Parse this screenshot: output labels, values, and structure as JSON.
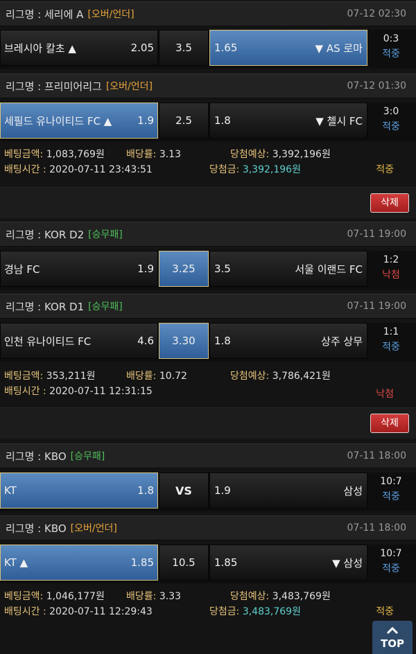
{
  "league_prefix": "리그명 : ",
  "colors": {
    "over_under": "#e8a63c",
    "win_draw_loss": "#4fbf5a",
    "hit": "#5a9ede",
    "miss": "#e04848"
  },
  "slips": [
    {
      "games": [
        {
          "league": "세리에 A",
          "type": "[오버/언더]",
          "type_color": "#e8a63c",
          "time": "07-12 02:30",
          "home": "브레시아 칼초 ▲",
          "home_odds": "2.05",
          "mid": "3.5",
          "away_odds": "1.65",
          "away": "▼ AS 로마",
          "selected": "away",
          "score": "0:3",
          "status": "적중"
        },
        {
          "league": "프리미어리그",
          "type": "[오버/언더]",
          "type_color": "#e8a63c",
          "time": "07-12 01:30",
          "home": "세필드 유나이티드 FC ▲",
          "home_odds": "1.9",
          "mid": "2.5",
          "away_odds": "1.8",
          "away": "▼ 첼시 FC",
          "selected": "home",
          "score": "3:0",
          "status": "적중"
        }
      ],
      "bet_amount_label": "베팅금액:",
      "bet_amount": "1,083,769원",
      "odds_label": "배당률:",
      "odds": "3.13",
      "expected_label": "당첨예상:",
      "expected": "3,392,196원",
      "bet_time_label": "배팅시간 : ",
      "bet_time": "2020-07-11 23:43:51",
      "win_label": "당첨금: ",
      "win_amount": "3,392,196원",
      "status": "적중",
      "delete_label": "삭제"
    },
    {
      "games": [
        {
          "league": "KOR D2",
          "type": "[승무패]",
          "type_color": "#4fbf5a",
          "time": "07-11 19:00",
          "home": "경남 FC",
          "home_odds": "1.9",
          "mid": "3.25",
          "away_odds": "3.5",
          "away": "서울 이랜드 FC",
          "selected": "mid",
          "score": "1:2",
          "status": "낙첨"
        },
        {
          "league": "KOR D1",
          "type": "[승무패]",
          "type_color": "#4fbf5a",
          "time": "07-11 19:00",
          "home": "인천 유나이티드 FC",
          "home_odds": "4.6",
          "mid": "3.30",
          "away_odds": "1.8",
          "away": "상주 상무",
          "selected": "mid",
          "score": "1:1",
          "status": "적중"
        }
      ],
      "bet_amount_label": "베팅금액:",
      "bet_amount": "353,211원",
      "odds_label": "배당률:",
      "odds": "10.72",
      "expected_label": "당첨예상:",
      "expected": "3,786,421원",
      "bet_time_label": "배팅시간 : ",
      "bet_time": "2020-07-11 12:31:15",
      "status": "낙첨",
      "delete_label": "삭제"
    },
    {
      "games": [
        {
          "league": "KBO",
          "type": "[승무패]",
          "type_color": "#4fbf5a",
          "time": "07-11 18:00",
          "home": "KT",
          "home_odds": "1.8",
          "mid": "VS",
          "away_odds": "1.9",
          "away": "삼성",
          "selected": "home",
          "score": "10:7",
          "status": "적중"
        },
        {
          "league": "KBO",
          "type": "[오버/언더]",
          "type_color": "#e8a63c",
          "time": "07-11 18:00",
          "home": "KT ▲",
          "home_odds": "1.85",
          "mid": "10.5",
          "away_odds": "1.85",
          "away": "▼ 삼성",
          "selected": "home",
          "score": "10:7",
          "status": "적중"
        }
      ],
      "bet_amount_label": "베팅금액:",
      "bet_amount": "1,046,177원",
      "odds_label": "배당률:",
      "odds": "3.33",
      "expected_label": "당첨예상:",
      "expected": "3,483,769원",
      "bet_time_label": "배팅시간 : ",
      "bet_time": "2020-07-11 12:29:43",
      "win_label": "당첨금: ",
      "win_amount": "3,483,769원",
      "status": "적중"
    }
  ],
  "top_button": {
    "icon": "chevron-up-icon",
    "label": "TOP"
  }
}
